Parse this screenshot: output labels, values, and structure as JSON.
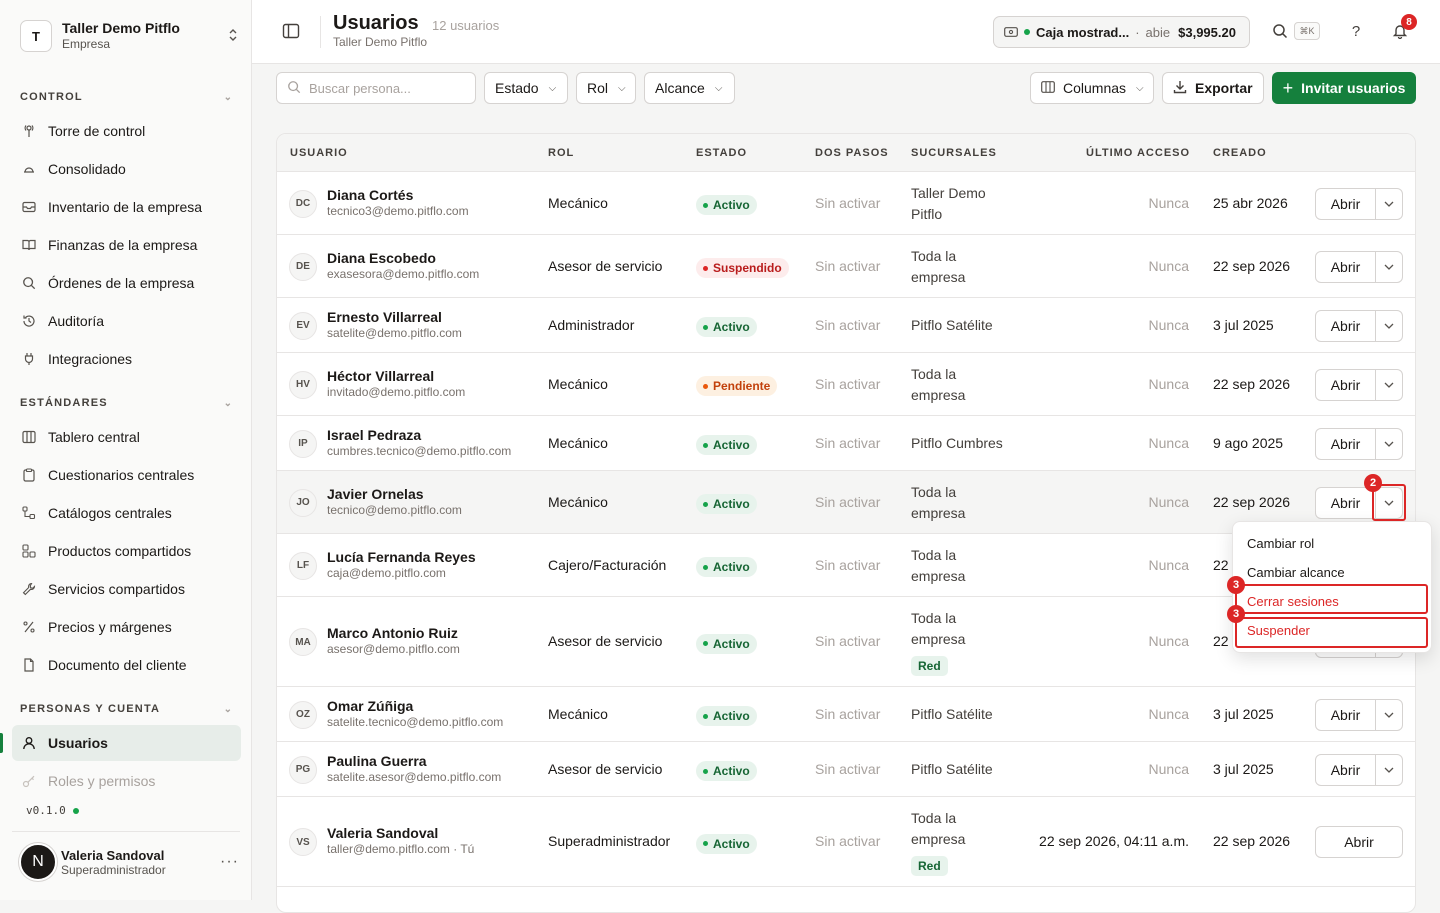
{
  "org": {
    "initial": "T",
    "name": "Taller Demo Pitflo",
    "type": "Empresa"
  },
  "sections": {
    "control": "CONTROL",
    "estandares": "ESTÁNDARES",
    "personas": "PERSONAS Y CUENTA"
  },
  "nav": {
    "control": [
      {
        "label": "Torre de control",
        "icon": "tower-icon"
      },
      {
        "label": "Consolidado",
        "icon": "cloud-icon"
      },
      {
        "label": "Inventario de la empresa",
        "icon": "inbox-icon"
      },
      {
        "label": "Finanzas de la empresa",
        "icon": "book-icon"
      },
      {
        "label": "Órdenes de la empresa",
        "icon": "search-icon"
      },
      {
        "label": "Auditoría",
        "icon": "history-icon"
      },
      {
        "label": "Integraciones",
        "icon": "plug-icon"
      }
    ],
    "estandares": [
      {
        "label": "Tablero central",
        "icon": "columns-icon"
      },
      {
        "label": "Cuestionarios centrales",
        "icon": "clipboard-icon"
      },
      {
        "label": "Catálogos centrales",
        "icon": "tree-icon"
      },
      {
        "label": "Productos compartidos",
        "icon": "boxes-icon"
      },
      {
        "label": "Servicios compartidos",
        "icon": "wrench-icon"
      },
      {
        "label": "Precios y márgenes",
        "icon": "percent-icon"
      },
      {
        "label": "Documento del cliente",
        "icon": "file-icon"
      }
    ],
    "personas": [
      {
        "label": "Usuarios",
        "icon": "user-icon"
      },
      {
        "label": "Roles y permisos",
        "icon": "key-icon"
      }
    ]
  },
  "version": "v0.1.0",
  "current_user": {
    "initial": "N",
    "name": "Valeria Sandoval",
    "role": "Superadministrador",
    "more": "···"
  },
  "header": {
    "title": "Usuarios",
    "count": "12 usuarios",
    "subtitle": "Taller Demo Pitflo"
  },
  "caja": {
    "name": "Caja mostrad...",
    "sep": "·",
    "status": "abie",
    "amount": "$3,995.20"
  },
  "shortcut": "⌘K",
  "notifications": "8",
  "filters": {
    "search_placeholder": "Buscar persona...",
    "estado": "Estado",
    "rol": "Rol",
    "alcance": "Alcance",
    "columnas": "Columnas",
    "exportar": "Exportar",
    "invitar": "Invitar usuarios"
  },
  "columns": [
    "USUARIO",
    "ROL",
    "ESTADO",
    "DOS PASOS",
    "SUCURSALES",
    "ÚLTIMO ACCESO",
    "CREADO"
  ],
  "rows": [
    {
      "initials": "DC",
      "name": "Diana Cortés",
      "email": "tecnico3@demo.pitflo.com",
      "role": "Mecánico",
      "status": "Activo",
      "status_kind": "act",
      "two_step": "Sin activar",
      "branches": [
        "Taller Demo",
        "Pitflo"
      ],
      "tag": "",
      "last": "Nunca",
      "created": "25 abr 2026",
      "open": "Abrir"
    },
    {
      "initials": "DE",
      "name": "Diana Escobedo",
      "email": "exasesora@demo.pitflo.com",
      "role": "Asesor de servicio",
      "status": "Suspendido",
      "status_kind": "sus",
      "two_step": "Sin activar",
      "branches": [
        "Toda la",
        "empresa"
      ],
      "tag": "",
      "last": "Nunca",
      "created": "22 sep 2026",
      "open": "Abrir"
    },
    {
      "initials": "EV",
      "name": "Ernesto Villarreal",
      "email": "satelite@demo.pitflo.com",
      "role": "Administrador",
      "status": "Activo",
      "status_kind": "act",
      "two_step": "Sin activar",
      "branches": [
        "Pitflo Satélite"
      ],
      "tag": "",
      "last": "Nunca",
      "created": "3 jul 2025",
      "open": "Abrir"
    },
    {
      "initials": "HV",
      "name": "Héctor Villarreal",
      "email": "invitado@demo.pitflo.com",
      "role": "Mecánico",
      "status": "Pendiente",
      "status_kind": "pen",
      "two_step": "Sin activar",
      "branches": [
        "Toda la",
        "empresa"
      ],
      "tag": "",
      "last": "Nunca",
      "created": "22 sep 2026",
      "open": "Abrir"
    },
    {
      "initials": "IP",
      "name": "Israel Pedraza",
      "email": "cumbres.tecnico@demo.pitflo.com",
      "role": "Mecánico",
      "status": "Activo",
      "status_kind": "act",
      "two_step": "Sin activar",
      "branches": [
        "Pitflo Cumbres"
      ],
      "tag": "",
      "last": "Nunca",
      "created": "9 ago 2025",
      "open": "Abrir"
    },
    {
      "initials": "JO",
      "name": "Javier Ornelas",
      "email": "tecnico@demo.pitflo.com",
      "role": "Mecánico",
      "status": "Activo",
      "status_kind": "act",
      "two_step": "Sin activar",
      "branches": [
        "Toda la",
        "empresa"
      ],
      "tag": "",
      "last": "Nunca",
      "created": "22 sep 2026",
      "open": "Abrir"
    },
    {
      "initials": "LF",
      "name": "Lucía Fernanda Reyes",
      "email": "caja@demo.pitflo.com",
      "role": "Cajero/Facturación",
      "status": "Activo",
      "status_kind": "act",
      "two_step": "Sin activar",
      "branches": [
        "Toda la",
        "empresa"
      ],
      "tag": "",
      "last": "Nunca",
      "created": "22",
      "open": "Abrir"
    },
    {
      "initials": "MA",
      "name": "Marco Antonio Ruiz",
      "email": "asesor@demo.pitflo.com",
      "role": "Asesor de servicio",
      "status": "Activo",
      "status_kind": "act",
      "two_step": "Sin activar",
      "branches": [
        "Toda la",
        "empresa"
      ],
      "tag": "Red",
      "last": "Nunca",
      "created": "22",
      "open": "Abrir"
    },
    {
      "initials": "OZ",
      "name": "Omar Zúñiga",
      "email": "satelite.tecnico@demo.pitflo.com",
      "role": "Mecánico",
      "status": "Activo",
      "status_kind": "act",
      "two_step": "Sin activar",
      "branches": [
        "Pitflo Satélite"
      ],
      "tag": "",
      "last": "Nunca",
      "created": "3 jul 2025",
      "open": "Abrir"
    },
    {
      "initials": "PG",
      "name": "Paulina Guerra",
      "email": "satelite.asesor@demo.pitflo.com",
      "role": "Asesor de servicio",
      "status": "Activo",
      "status_kind": "act",
      "two_step": "Sin activar",
      "branches": [
        "Pitflo Satélite"
      ],
      "tag": "",
      "last": "Nunca",
      "created": "3 jul 2025",
      "open": "Abrir"
    },
    {
      "initials": "VS",
      "name": "Valeria Sandoval",
      "email": "taller@demo.pitflo.com · Tú",
      "role": "Superadministrador",
      "status": "Activo",
      "status_kind": "act",
      "two_step": "Sin activar",
      "branches": [
        "Toda la",
        "empresa"
      ],
      "tag": "Red",
      "last": "22 sep 2026, 04:11 a.m.",
      "created": "22 sep 2026",
      "open": "Abrir"
    }
  ],
  "menu": [
    "Cambiar rol",
    "Cambiar alcance",
    "Cerrar sesiones",
    "Suspender"
  ],
  "markers": {
    "dropdown": "2",
    "menu_a": "3",
    "menu_b": "3"
  },
  "colors": {
    "accent": "#15803d",
    "danger": "#dc2626"
  }
}
